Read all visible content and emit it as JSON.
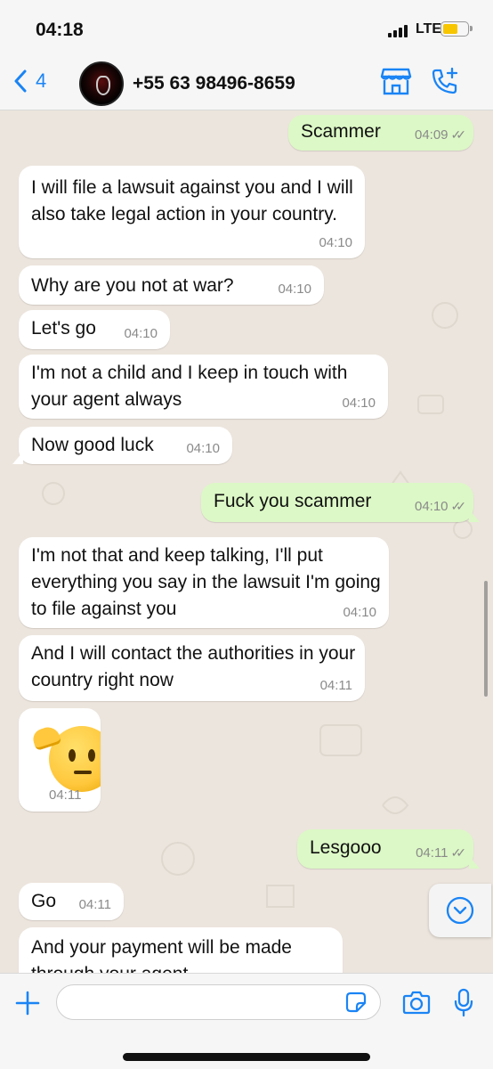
{
  "status_bar": {
    "time": "04:18",
    "network": "LTE"
  },
  "header": {
    "back_count": "4",
    "contact_name": "+55 63 98496-8659"
  },
  "messages": [
    {
      "dir": "out",
      "text": "Scammer",
      "time": "04:09"
    },
    {
      "dir": "in",
      "text": "I will file a lawsuit against you and I will also take legal action in your country.",
      "time": "04:10"
    },
    {
      "dir": "in",
      "text": "Why are you not at war?",
      "time": "04:10"
    },
    {
      "dir": "in",
      "text": "Let's go",
      "time": "04:10"
    },
    {
      "dir": "in",
      "text": "I'm not a child and I keep in touch with your agent always",
      "time": "04:10"
    },
    {
      "dir": "in",
      "text": "Now good luck",
      "time": "04:10"
    },
    {
      "dir": "out",
      "text": "Fuck you scammer",
      "time": "04:10"
    },
    {
      "dir": "in",
      "text": "I'm not that and keep talking, I'll put everything you say in the lawsuit I'm going to file against you",
      "time": "04:10"
    },
    {
      "dir": "in",
      "text": "And I will contact the authorities in your country right now",
      "time": "04:11"
    },
    {
      "dir": "in",
      "emoji": "saluting-face",
      "time": "04:11"
    },
    {
      "dir": "out",
      "text": "Lesgooo",
      "time": "04:11"
    },
    {
      "dir": "in",
      "text": "Go",
      "time": "04:11"
    },
    {
      "dir": "in",
      "text": "And your payment will be made through your agent",
      "time": ""
    }
  ],
  "input": {
    "placeholder": ""
  },
  "colors": {
    "accent": "#1a84f5",
    "outgoing_bubble": "#dcf8c6",
    "incoming_bubble": "#ffffff",
    "chat_bg": "#ece5dd"
  }
}
